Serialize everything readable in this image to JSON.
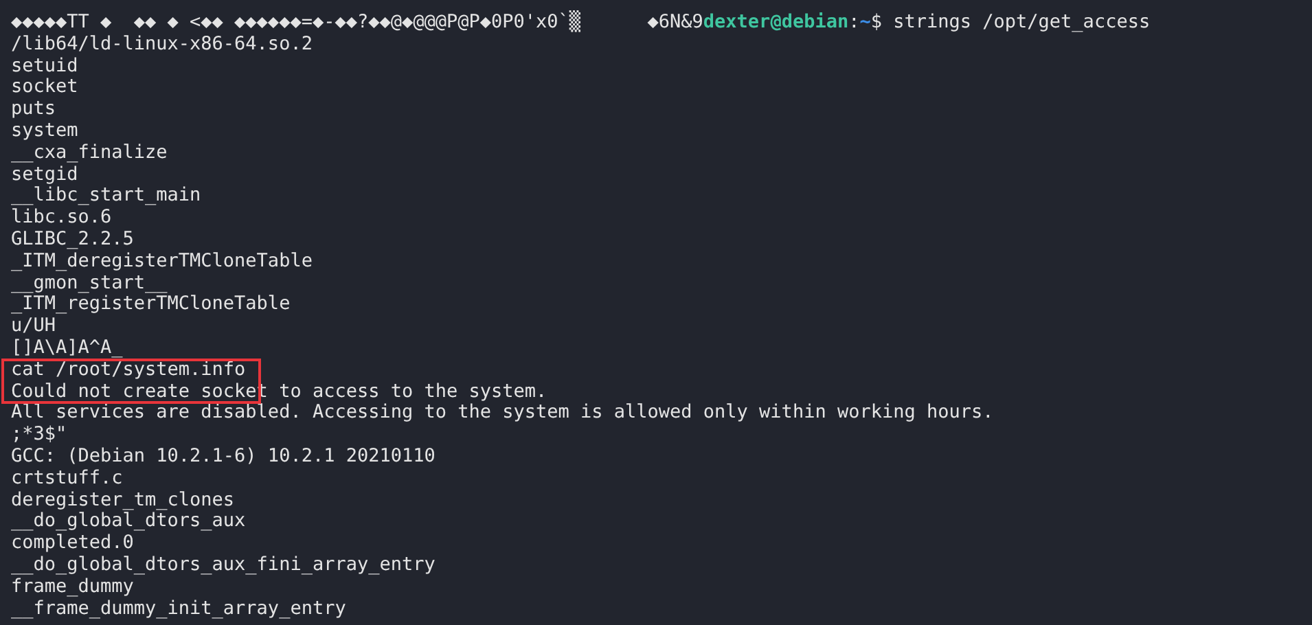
{
  "terminal": {
    "prompt_line": {
      "prefix": "◆◆◆◆◆TT ◆  ◆◆ ◆ <◆◆ ◆◆◆◆◆◆=◆-◆◆?◆◆@◆@@@P@P◆0P0'x0`▒      ◆6N&9",
      "user_host": "dexter@debian",
      "separator": ":",
      "path": "~",
      "symbol": "$",
      "command": "strings /opt/get_access"
    },
    "output": [
      {
        "kind": "line",
        "text": "/lib64/ld-linux-x86-64.so.2"
      },
      {
        "kind": "line",
        "text": "setuid"
      },
      {
        "kind": "line",
        "text": "socket"
      },
      {
        "kind": "line",
        "text": "puts"
      },
      {
        "kind": "line",
        "text": "system"
      },
      {
        "kind": "line",
        "text": "__cxa_finalize"
      },
      {
        "kind": "line",
        "text": "setgid"
      },
      {
        "kind": "line",
        "text": "__libc_start_main"
      },
      {
        "kind": "line",
        "text": "libc.so.6"
      },
      {
        "kind": "line",
        "text": "GLIBC_2.2.5"
      },
      {
        "kind": "line",
        "text": "_ITM_deregisterTMCloneTable"
      },
      {
        "kind": "line",
        "text": "__gmon_start__"
      },
      {
        "kind": "line",
        "text": "_ITM_registerTMCloneTable"
      },
      {
        "kind": "line",
        "text": "u/UH"
      },
      {
        "kind": "line",
        "text": "[]A\\A]A^A_"
      },
      {
        "kind": "highlight",
        "lines": [
          "cat /root/system.info",
          "Could not create socket to access to the system."
        ]
      },
      {
        "kind": "line",
        "text": "All services are disabled. Accessing to the system is allowed only within working hours."
      },
      {
        "kind": "line",
        "text": ";*3$\""
      },
      {
        "kind": "line",
        "text": "GCC: (Debian 10.2.1-6) 10.2.1 20210110"
      },
      {
        "kind": "line",
        "text": "crtstuff.c"
      },
      {
        "kind": "line",
        "text": "deregister_tm_clones"
      },
      {
        "kind": "line",
        "text": "__do_global_dtors_aux"
      },
      {
        "kind": "line",
        "text": "completed.0"
      },
      {
        "kind": "line",
        "text": "__do_global_dtors_aux_fini_array_entry"
      },
      {
        "kind": "line",
        "text": "frame_dummy"
      },
      {
        "kind": "line",
        "text": "__frame_dummy_init_array_entry"
      }
    ]
  }
}
